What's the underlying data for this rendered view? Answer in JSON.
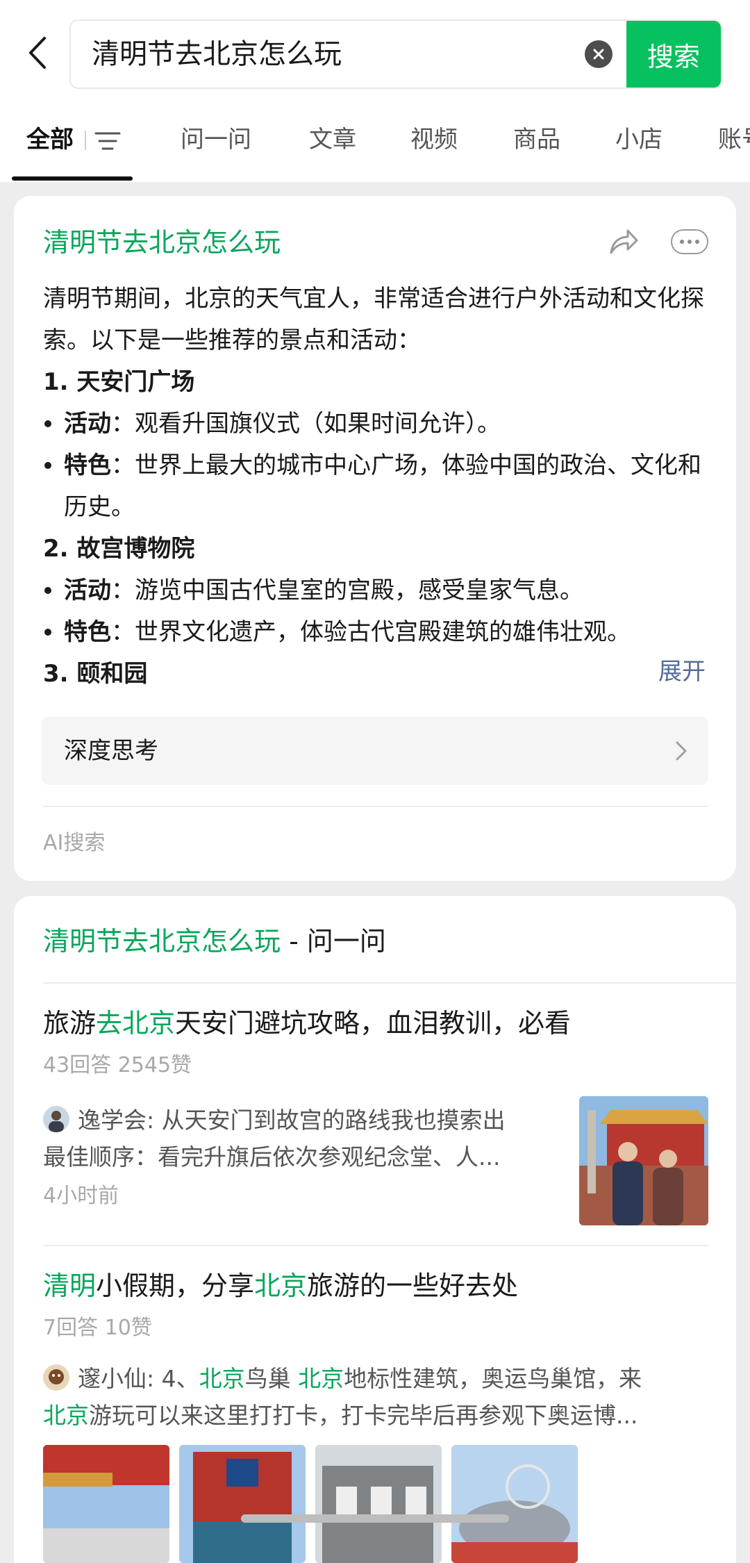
{
  "search": {
    "query": "清明节去北京怎么玩",
    "button_label": "搜索"
  },
  "tabs": [
    {
      "label": "全部",
      "active": true
    },
    {
      "label": "问一问"
    },
    {
      "label": "文章"
    },
    {
      "label": "视频"
    },
    {
      "label": "商品"
    },
    {
      "label": "小店"
    },
    {
      "label": "账号"
    }
  ],
  "ai_card": {
    "title": "清明节去北京怎么玩",
    "intro": "清明节期间，北京的天气宜人，非常适合进行户外活动和文化探索。以下是一些推荐的景点和活动：",
    "sections": [
      {
        "heading": "1. 天安门广场",
        "bullets": [
          {
            "key": "活动",
            "text": "：观看升国旗仪式（如果时间允许）。"
          },
          {
            "key": "特色",
            "text": "：世界上最大的城市中心广场，体验中国的政治、文化和历史。"
          }
        ]
      },
      {
        "heading": "2. 故宫博物院",
        "bullets": [
          {
            "key": "活动",
            "text": "：游览中国古代皇室的宫殿，感受皇家气息。"
          },
          {
            "key": "特色",
            "text": "：世界文化遗产，体验古代宫殿建筑的雄伟壮观。"
          }
        ]
      },
      {
        "heading": "3. 颐和园"
      }
    ],
    "expand_label": "展开",
    "deep_think_label": "深度思考",
    "source_label": "AI搜索"
  },
  "ask_card": {
    "header_highlight": "清明节去北京怎么玩",
    "header_suffix": " - 问一问",
    "items": [
      {
        "title_parts": [
          {
            "text": "旅游",
            "hl": false
          },
          {
            "text": "去北京",
            "hl": true
          },
          {
            "text": "天安门避坑攻略，血泪教训，必看",
            "hl": false
          }
        ],
        "meta": "43回答 2545赞",
        "author": "逸学会",
        "snippet_line1": "逸学会: 从天安门到故宫的路线我也摸索出",
        "snippet_line2": "最佳顺序：看完升旗后依次参观纪念堂、人...",
        "time": "4小时前"
      },
      {
        "title_parts": [
          {
            "text": "清明",
            "hl": true
          },
          {
            "text": "小假期，分享",
            "hl": false
          },
          {
            "text": "北京",
            "hl": true
          },
          {
            "text": "旅游的一些好去处",
            "hl": false
          }
        ],
        "meta": "7回答 10赞",
        "author": "邃小仙",
        "snippet_line1_parts": [
          {
            "text": "邃小仙: 4、",
            "hl": false
          },
          {
            "text": "北京",
            "hl": true
          },
          {
            "text": "鸟巢 ",
            "hl": false
          },
          {
            "text": "北京",
            "hl": true
          },
          {
            "text": "地标性建筑，奥运鸟巢馆，来",
            "hl": false
          }
        ],
        "snippet_line2_parts": [
          {
            "text": "北京",
            "hl": true
          },
          {
            "text": "游玩可以来这里打打卡，打卡完毕后再参观下奥运博...",
            "hl": false
          }
        ]
      }
    ]
  },
  "colors": {
    "accent_green": "#07c160",
    "highlight_green": "#07a65a",
    "link_blue": "#576b95"
  }
}
